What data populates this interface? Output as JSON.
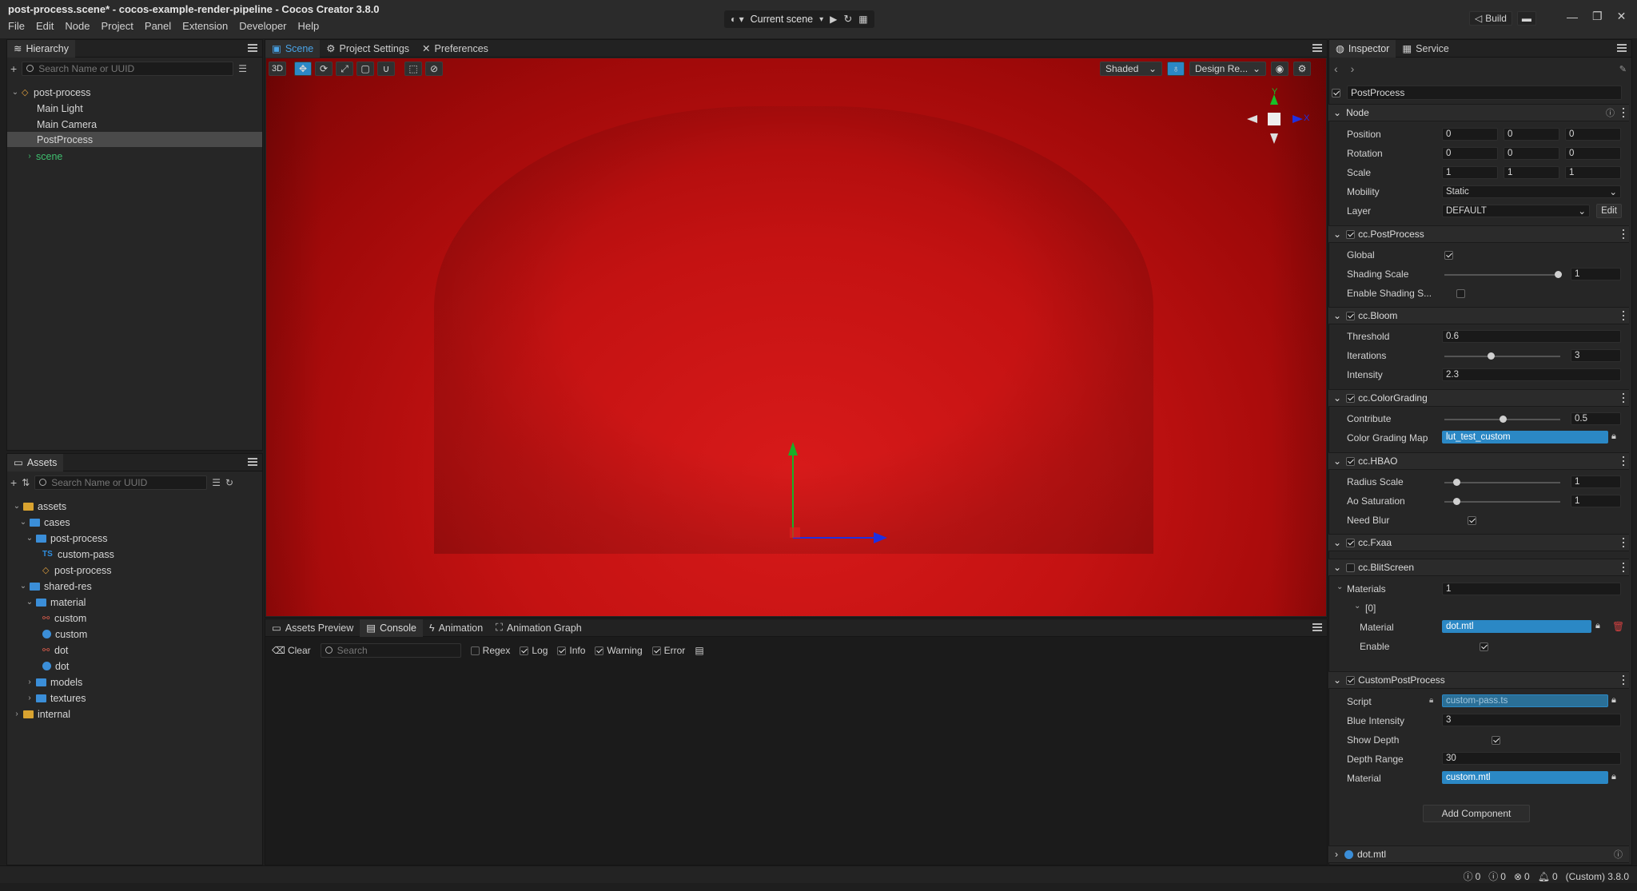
{
  "window": {
    "title": "post-process.scene* - cocos-example-render-pipeline - Cocos Creator 3.8.0"
  },
  "menu": [
    "File",
    "Edit",
    "Node",
    "Project",
    "Panel",
    "Extension",
    "Developer",
    "Help"
  ],
  "toolbar": {
    "scene_select": "Current scene",
    "build": "Build"
  },
  "hierarchy": {
    "tab": "Hierarchy",
    "search_placeholder": "Search Name or UUID",
    "items": [
      {
        "label": "post-process"
      },
      {
        "label": "Main Light"
      },
      {
        "label": "Main Camera"
      },
      {
        "label": "PostProcess"
      },
      {
        "label": "scene"
      }
    ]
  },
  "assets": {
    "tab": "Assets",
    "search_placeholder": "Search Name or UUID",
    "items": [
      {
        "label": "assets"
      },
      {
        "label": "cases"
      },
      {
        "label": "post-process"
      },
      {
        "label": "custom-pass"
      },
      {
        "label": "post-process"
      },
      {
        "label": "shared-res"
      },
      {
        "label": "material"
      },
      {
        "label": "custom"
      },
      {
        "label": "custom"
      },
      {
        "label": "dot"
      },
      {
        "label": "dot"
      },
      {
        "label": "models"
      },
      {
        "label": "textures"
      },
      {
        "label": "internal"
      }
    ]
  },
  "scene_tabs": {
    "scene": "Scene",
    "project_settings": "Project Settings",
    "preferences": "Preferences"
  },
  "scene_toolbar": {
    "mode": "3D",
    "shading": "Shaded",
    "resolution": "Design Re..."
  },
  "gizmo_axes": {
    "y": "Y",
    "x": "X",
    "z": "Z"
  },
  "console": {
    "tabs": [
      "Assets Preview",
      "Console",
      "Animation",
      "Animation Graph"
    ],
    "clear": "Clear",
    "search_placeholder": "Search",
    "filters": [
      {
        "label": "Regex",
        "checked": false
      },
      {
        "label": "Log",
        "checked": true
      },
      {
        "label": "Info",
        "checked": true
      },
      {
        "label": "Warning",
        "checked": true
      },
      {
        "label": "Error",
        "checked": true
      }
    ]
  },
  "inspector": {
    "tabs": [
      "Inspector",
      "Service"
    ],
    "node_name": "PostProcess",
    "node_section": "Node",
    "position_label": "Position",
    "position": [
      "0",
      "0",
      "0"
    ],
    "rotation_label": "Rotation",
    "rotation": [
      "0",
      "0",
      "0"
    ],
    "scale_label": "Scale",
    "scale": [
      "1",
      "1",
      "1"
    ],
    "mobility_label": "Mobility",
    "mobility": "Static",
    "layer_label": "Layer",
    "layer": "DEFAULT",
    "edit": "Edit",
    "postprocess": {
      "title": "cc.PostProcess",
      "global_label": "Global",
      "global": true,
      "shading_scale_label": "Shading Scale",
      "shading_scale": "1",
      "shading_scale_frac": 0.98,
      "enable_shading_label": "Enable Shading S...",
      "enable_shading": false
    },
    "bloom": {
      "title": "cc.Bloom",
      "threshold_label": "Threshold",
      "threshold": "0.6",
      "iterations_label": "Iterations",
      "iterations": "3",
      "iterations_frac": 0.4,
      "intensity_label": "Intensity",
      "intensity": "2.3"
    },
    "colorgrading": {
      "title": "cc.ColorGrading",
      "contribute_label": "Contribute",
      "contribute": "0.5",
      "contribute_frac": 0.5,
      "map_label": "Color Grading Map",
      "map": "lut_test_custom"
    },
    "hbao": {
      "title": "cc.HBAO",
      "radius_label": "Radius Scale",
      "radius": "1",
      "radius_frac": 0.1,
      "ao_label": "Ao Saturation",
      "ao": "1",
      "ao_frac": 0.1,
      "blur_label": "Need Blur",
      "blur": true
    },
    "fxaa": {
      "title": "cc.Fxaa"
    },
    "blit": {
      "title": "cc.BlitScreen",
      "materials_label": "Materials",
      "materials_count": "1",
      "index": "[0]",
      "material_label": "Material",
      "material": "dot.mtl",
      "enable_label": "Enable",
      "enable": true
    },
    "custom": {
      "title": "CustomPostProcess",
      "script_label": "Script",
      "script": "custom-pass.ts",
      "blue_label": "Blue Intensity",
      "blue": "3",
      "depth_label": "Show Depth",
      "depth": true,
      "range_label": "Depth Range",
      "range": "30",
      "material_label": "Material",
      "material": "custom.mtl"
    },
    "add_component": "Add Component",
    "footer_asset": "dot.mtl"
  },
  "status": {
    "c1": "0",
    "c2": "0",
    "c3": "0",
    "c4": "0",
    "version": "(Custom) 3.8.0"
  },
  "colors": {
    "accent": "#2b88c5",
    "scene_red": "#c41212"
  }
}
